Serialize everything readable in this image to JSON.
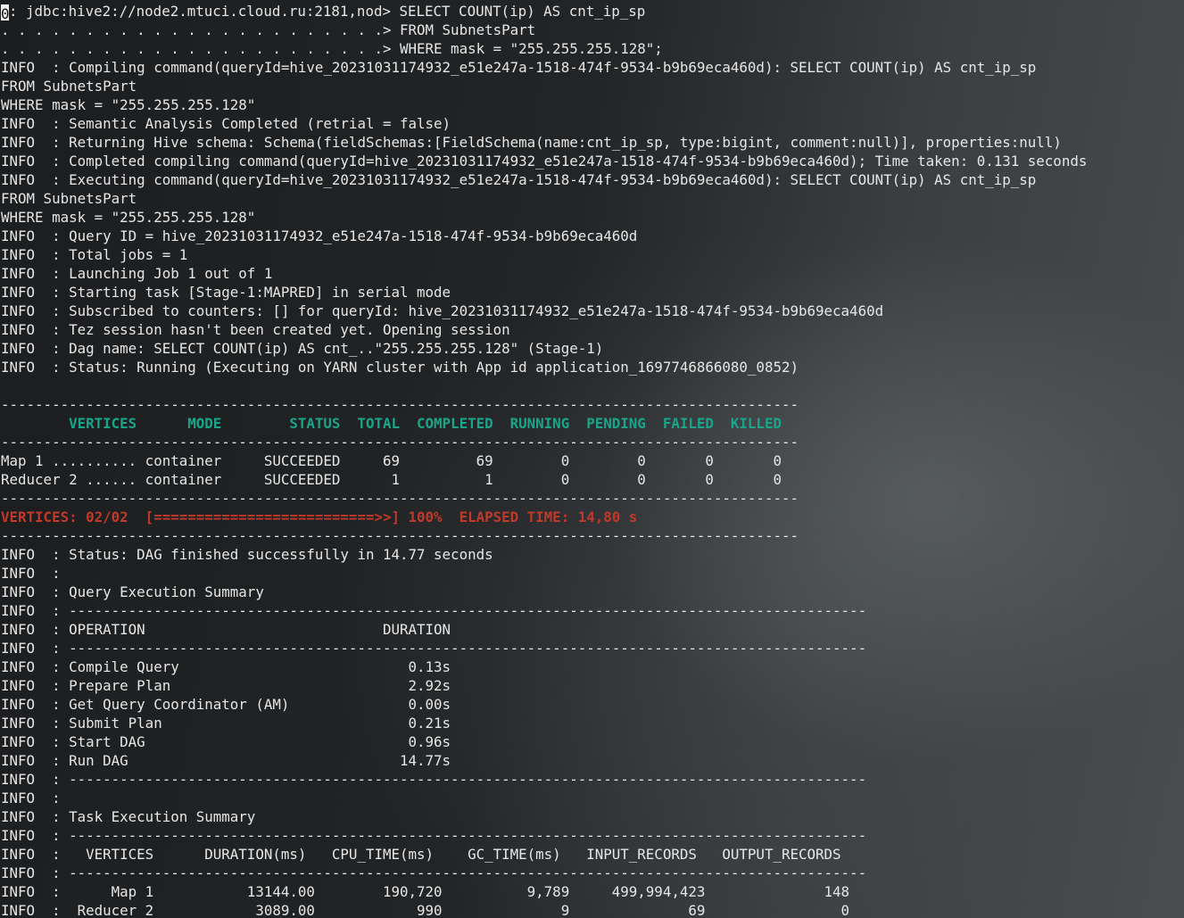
{
  "terminal": {
    "prompt": {
      "prefix": "0",
      "rest": ": jdbc:hive2://node2.mtuci.cloud.ru:2181,nod> SELECT COUNT(ip) AS cnt_ip_sp"
    },
    "lines": [
      ". . . . . . . . . . . . . . . . . . . . . . .> FROM SubnetsPart",
      ". . . . . . . . . . . . . . . . . . . . . . .> WHERE mask = \"255.255.255.128\";",
      "INFO  : Compiling command(queryId=hive_20231031174932_e51e247a-1518-474f-9534-b9b69eca460d): SELECT COUNT(ip) AS cnt_ip_sp",
      "FROM SubnetsPart",
      "WHERE mask = \"255.255.255.128\"",
      "INFO  : Semantic Analysis Completed (retrial = false)",
      "INFO  : Returning Hive schema: Schema(fieldSchemas:[FieldSchema(name:cnt_ip_sp, type:bigint, comment:null)], properties:null)",
      "INFO  : Completed compiling command(queryId=hive_20231031174932_e51e247a-1518-474f-9534-b9b69eca460d); Time taken: 0.131 seconds",
      "INFO  : Executing command(queryId=hive_20231031174932_e51e247a-1518-474f-9534-b9b69eca460d): SELECT COUNT(ip) AS cnt_ip_sp",
      "FROM SubnetsPart",
      "WHERE mask = \"255.255.255.128\"",
      "INFO  : Query ID = hive_20231031174932_e51e247a-1518-474f-9534-b9b69eca460d",
      "INFO  : Total jobs = 1",
      "INFO  : Launching Job 1 out of 1",
      "INFO  : Starting task [Stage-1:MAPRED] in serial mode",
      "INFO  : Subscribed to counters: [] for queryId: hive_20231031174932_e51e247a-1518-474f-9534-b9b69eca460d",
      "INFO  : Tez session hasn't been created yet. Opening session",
      "INFO  : Dag name: SELECT COUNT(ip) AS cnt_..\"255.255.255.128\" (Stage-1)",
      "INFO  : Status: Running (Executing on YARN cluster with App id application_1697746866080_0852)",
      "",
      "----------------------------------------------------------------------------------------------"
    ],
    "vertices_header": "        VERTICES      MODE        STATUS  TOTAL  COMPLETED  RUNNING  PENDING  FAILED  KILLED",
    "separator": "----------------------------------------------------------------------------------------------",
    "vertex_rows": [
      "Map 1 .......... container     SUCCEEDED     69         69        0        0       0       0",
      "Reducer 2 ...... container     SUCCEEDED      1          1        0        0       0       0"
    ],
    "progress_line": "VERTICES: 02/02  [==========================>>] 100%  ELAPSED TIME: 14,80 s",
    "tail_lines": [
      "INFO  : Status: DAG finished successfully in 14.77 seconds",
      "INFO  :",
      "INFO  : Query Execution Summary",
      "INFO  : ----------------------------------------------------------------------------------------------",
      "INFO  : OPERATION                            DURATION",
      "INFO  : ----------------------------------------------------------------------------------------------",
      "INFO  : Compile Query                           0.13s",
      "INFO  : Prepare Plan                            2.92s",
      "INFO  : Get Query Coordinator (AM)              0.00s",
      "INFO  : Submit Plan                             0.21s",
      "INFO  : Start DAG                               0.96s",
      "INFO  : Run DAG                                14.77s",
      "INFO  : ----------------------------------------------------------------------------------------------",
      "INFO  :",
      "INFO  : Task Execution Summary",
      "INFO  : ----------------------------------------------------------------------------------------------",
      "INFO  :   VERTICES      DURATION(ms)   CPU_TIME(ms)    GC_TIME(ms)   INPUT_RECORDS   OUTPUT_RECORDS",
      "INFO  : ----------------------------------------------------------------------------------------------",
      "INFO  :      Map 1           13144.00        190,720          9,789     499,994,423              148",
      "INFO  :  Reducer 2            3089.00            990              9              69                0"
    ]
  }
}
